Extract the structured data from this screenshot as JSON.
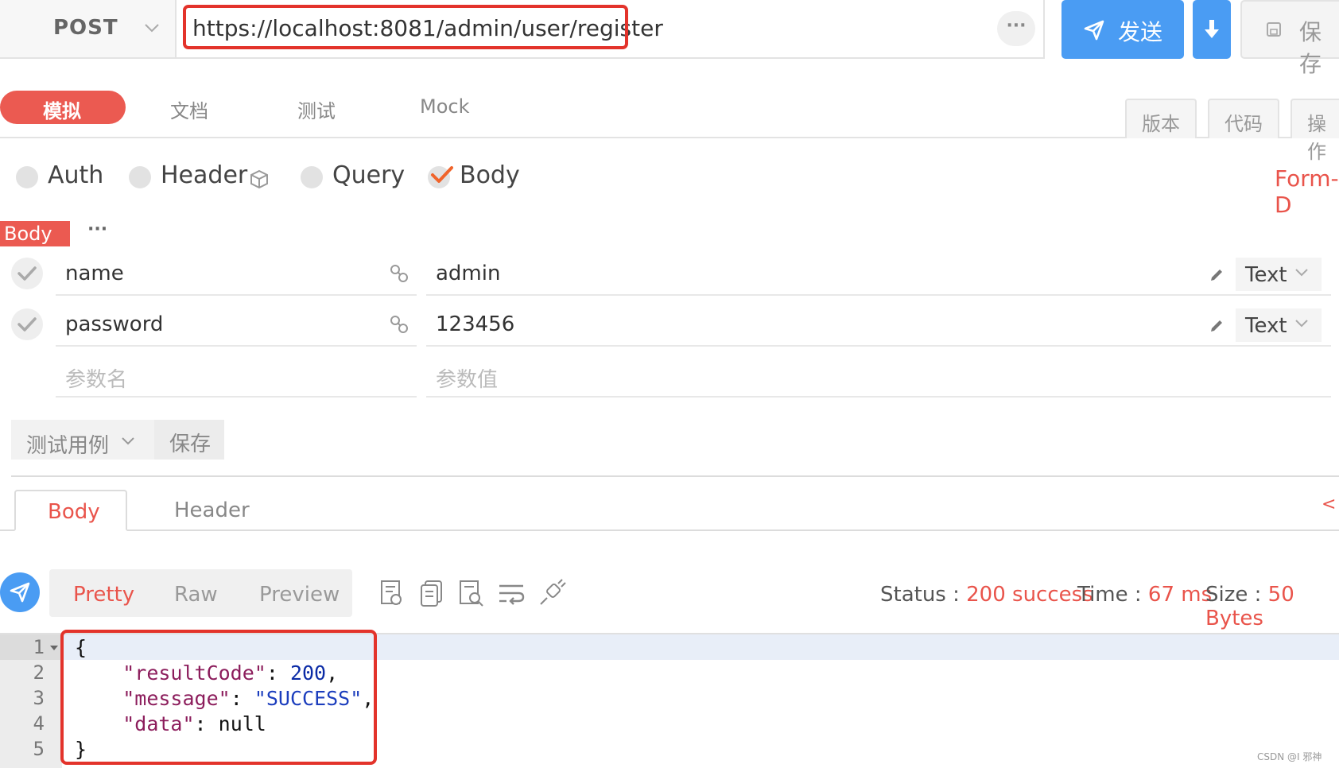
{
  "request": {
    "method": "POST",
    "url": "https://localhost:8081/admin/user/register",
    "more_label": "···",
    "send_label": "发送",
    "save_label": "保存"
  },
  "tabs": [
    {
      "label": "模拟",
      "active": true
    },
    {
      "label": "文档",
      "active": false
    },
    {
      "label": "测试",
      "active": false
    },
    {
      "label": "Mock",
      "active": false
    }
  ],
  "right_tabs": [
    {
      "label": "版本"
    },
    {
      "label": "代码"
    },
    {
      "label": "操作"
    }
  ],
  "options": [
    {
      "label": "Auth",
      "checked": false
    },
    {
      "label": "Header",
      "checked": false
    },
    {
      "label": "Query",
      "checked": false
    },
    {
      "label": "Body",
      "checked": true
    }
  ],
  "body_format": "Form-D",
  "body_section": {
    "tag": "Body",
    "more": "···"
  },
  "params": [
    {
      "name": "name",
      "value": "admin",
      "type": "Text"
    },
    {
      "name": "password",
      "value": "123456",
      "type": "Text"
    }
  ],
  "param_placeholders": {
    "name": "参数名",
    "value": "参数值"
  },
  "test_case": {
    "select_label": "测试用例",
    "save_label": "保存"
  },
  "response_tabs": [
    {
      "label": "Body",
      "active": true
    },
    {
      "label": "Header",
      "active": false
    }
  ],
  "collapse_label": "<",
  "view_modes": [
    {
      "label": "Pretty",
      "active": true
    },
    {
      "label": "Raw",
      "active": false
    },
    {
      "label": "Preview",
      "active": false
    }
  ],
  "status": {
    "status_label": "Status : ",
    "status_value": "200 success",
    "time_label": "Time : ",
    "time_value": "67 ms",
    "size_label": "Size : ",
    "size_value": "50 Bytes"
  },
  "code_lines": [
    "1",
    "2",
    "3",
    "4",
    "5"
  ],
  "response_json": {
    "resultCode": "200",
    "message": "SUCCESS",
    "data": "null"
  },
  "watermark": "CSDN @I 邪神",
  "colors": {
    "accent_red": "#eb5a51",
    "primary_blue": "#4a9cf3",
    "highlight_box": "#e3332b"
  }
}
